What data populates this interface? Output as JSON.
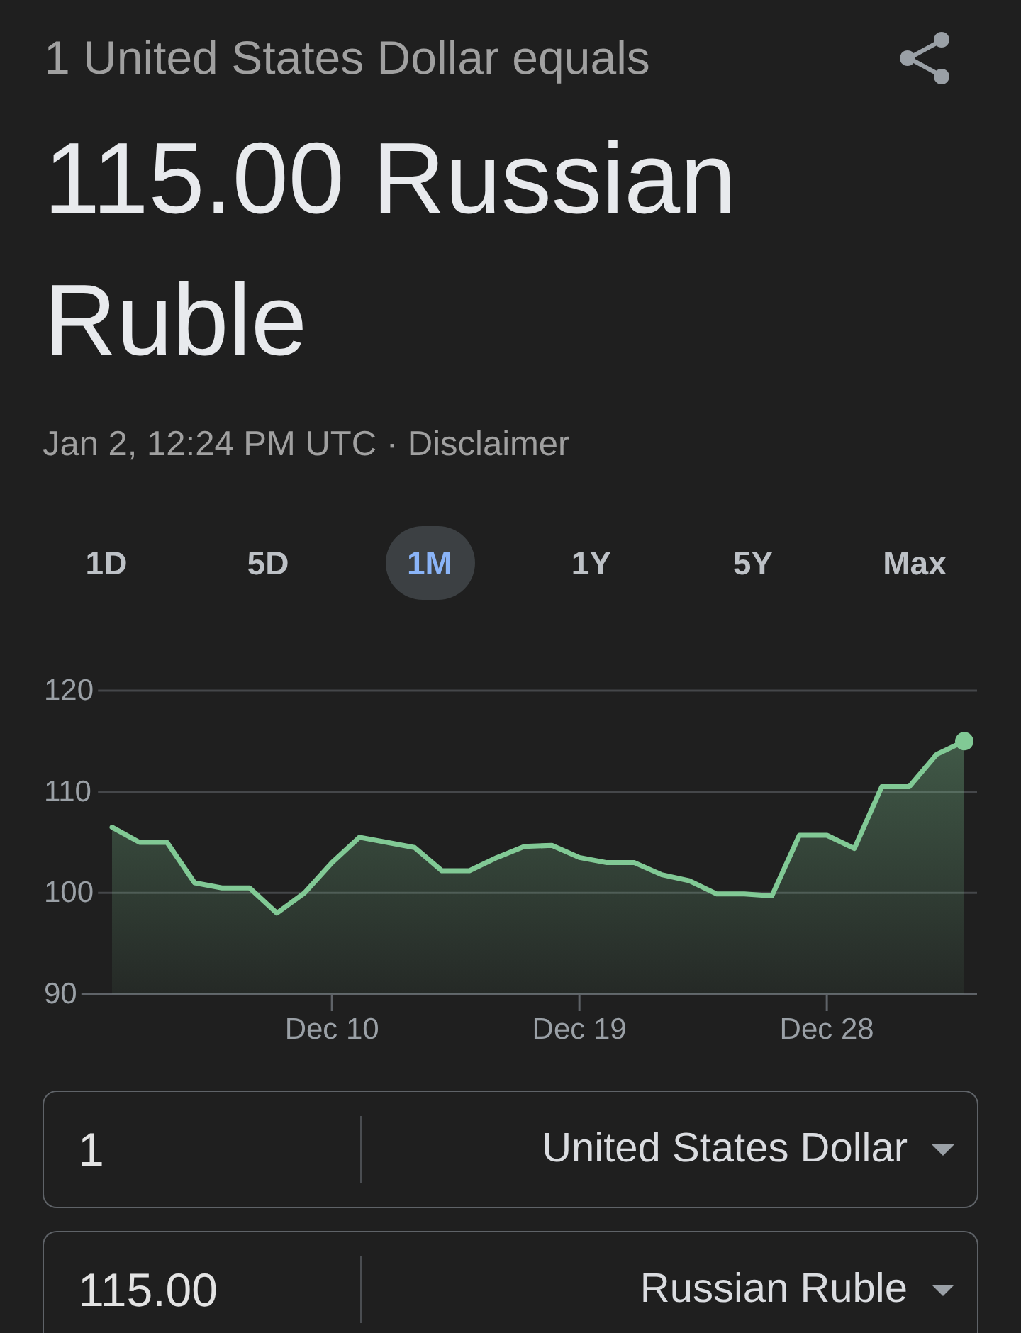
{
  "header": {
    "conversion_label": "1 United States Dollar equals",
    "result": "115.00 Russian Ruble"
  },
  "timestamp": {
    "text": "Jan 2, 12:24 PM UTC",
    "separator": "·",
    "disclaimer_link": "Disclaimer"
  },
  "range_tabs": [
    {
      "label": "1D",
      "selected": false
    },
    {
      "label": "5D",
      "selected": false
    },
    {
      "label": "1M",
      "selected": true
    },
    {
      "label": "1Y",
      "selected": false
    },
    {
      "label": "5Y",
      "selected": false
    },
    {
      "label": "Max",
      "selected": false
    }
  ],
  "chart": {
    "chart_data": {
      "type": "area",
      "categories": [
        null,
        null,
        null,
        null,
        null,
        null,
        null,
        null,
        "Dec 10",
        null,
        null,
        null,
        null,
        null,
        null,
        null,
        null,
        "Dec 19",
        null,
        null,
        null,
        null,
        null,
        null,
        null,
        null,
        "Dec 28",
        null,
        null,
        null,
        null,
        null
      ],
      "values": [
        106.5,
        105.0,
        105.0,
        101.0,
        100.5,
        100.5,
        98.0,
        100.0,
        103.0,
        105.5,
        105.0,
        104.5,
        102.2,
        102.2,
        103.5,
        104.6,
        104.7,
        103.5,
        103.0,
        103.0,
        101.8,
        101.2,
        99.9,
        99.9,
        99.7,
        105.7,
        105.7,
        104.4,
        110.5,
        110.5,
        113.7,
        115.0
      ],
      "ylim": [
        90,
        120
      ],
      "yticks": [
        90,
        100,
        110,
        120
      ]
    }
  },
  "converter": [
    {
      "amount": "1",
      "currency": "United States Dollar"
    },
    {
      "amount": "115.00",
      "currency": "Russian Ruble"
    }
  ]
}
